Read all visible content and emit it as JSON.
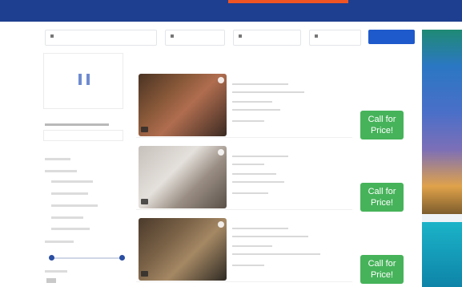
{
  "promo": {
    "text": ""
  },
  "header": {
    "nav": [
      "",
      "",
      "",
      "",
      ""
    ]
  },
  "search": {
    "destination": "",
    "checkin": "",
    "checkout": "",
    "guests": "",
    "button": ""
  },
  "sidebar": {
    "title": ""
  },
  "results": {
    "sort_label": "",
    "items": [
      {
        "name": "",
        "price_label": "Call for Price!"
      },
      {
        "name": "",
        "price_label": "Call for Price!"
      },
      {
        "name": "",
        "price_label": "Call for Price!"
      }
    ]
  },
  "call_price_lines": [
    "Call for",
    "Price!"
  ],
  "ad": {
    "line1": "",
    "line2": ""
  }
}
